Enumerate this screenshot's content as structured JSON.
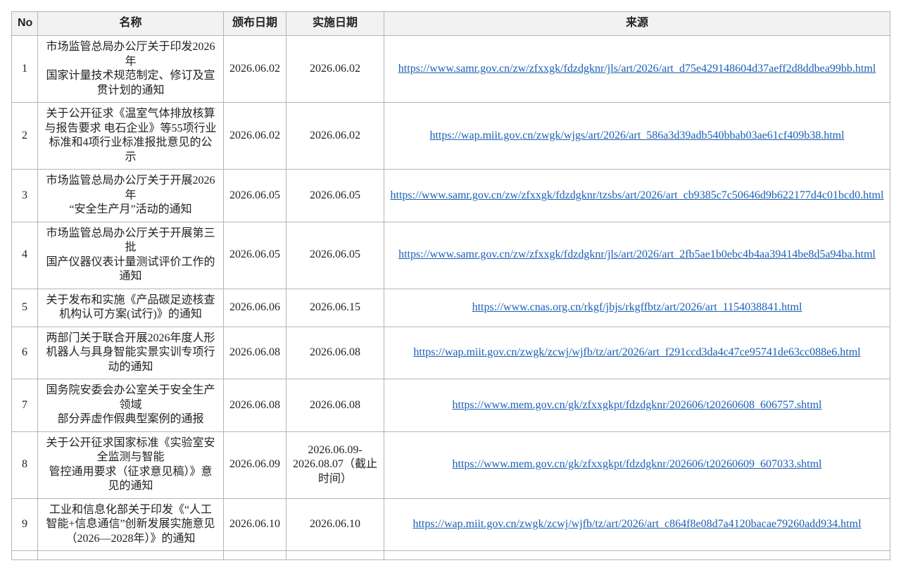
{
  "table": {
    "headers": {
      "no": "No",
      "name": "名称",
      "issue_date": "颁布日期",
      "impl_date": "实施日期",
      "source": "来源"
    },
    "rows": [
      {
        "no": "1",
        "name": "市场监管总局办公厅关于印发2026年\n国家计量技术规范制定、修订及宣贯计划的通知",
        "issue_date": "2026.06.02",
        "impl_date": "2026.06.02",
        "source": "https://www.samr.gov.cn/zw/zfxxgk/fdzdgknr/jls/art/2026/art_d75e429148604d37aeff2d8ddbea99bb.html"
      },
      {
        "no": "2",
        "name": "关于公开征求《温室气体排放核算与报告要求 电石企业》等55项行业标准和4项行业标准报批意见的公示",
        "issue_date": "2026.06.02",
        "impl_date": "2026.06.02",
        "source": "https://wap.miit.gov.cn/zwgk/wjgs/art/2026/art_586a3d39adb540bbab03ae61cf409b38.html"
      },
      {
        "no": "3",
        "name": "市场监管总局办公厅关于开展2026年\n“安全生产月”活动的通知",
        "issue_date": "2026.06.05",
        "impl_date": "2026.06.05",
        "source": "https://www.samr.gov.cn/zw/zfxxgk/fdzdgknr/tzsbs/art/2026/art_cb9385c7c50646d9b622177d4c01bcd0.html"
      },
      {
        "no": "4",
        "name": "市场监管总局办公厅关于开展第三批\n国产仪器仪表计量测试评价工作的通知",
        "issue_date": "2026.06.05",
        "impl_date": "2026.06.05",
        "source": "https://www.samr.gov.cn/zw/zfxxgk/fdzdgknr/jls/art/2026/art_2fb5ae1b0ebc4b4aa39414be8d5a94ba.html"
      },
      {
        "no": "5",
        "name": "关于发布和实施《产品碳足迹核查机构认可方案(试行)》的通知",
        "issue_date": "2026.06.06",
        "impl_date": "2026.06.15",
        "source": "https://www.cnas.org.cn/rkgf/jbjs/rkgffbtz/art/2026/art_1154038841.html"
      },
      {
        "no": "6",
        "name": "两部门关于联合开展2026年度人形机器人与具身智能实景实训专项行动的通知",
        "issue_date": "2026.06.08",
        "impl_date": "2026.06.08",
        "source": "https://wap.miit.gov.cn/zwgk/zcwj/wjfb/tz/art/2026/art_f291ccd3da4c47ce95741de63cc088e6.html"
      },
      {
        "no": "7",
        "name": "国务院安委会办公室关于安全生产领域\n部分弄虚作假典型案例的通报",
        "issue_date": "2026.06.08",
        "impl_date": "2026.06.08",
        "source": "https://www.mem.gov.cn/gk/zfxxgkpt/fdzdgknr/202606/t20260608_606757.shtml"
      },
      {
        "no": "8",
        "name": "关于公开征求国家标准《实验室安全监测与智能\n管控通用要求（征求意见稿）》意见的通知",
        "issue_date": "2026.06.09",
        "impl_date": "2026.06.09-2026.08.07（截止时间）",
        "source": "https://www.mem.gov.cn/gk/zfxxgkpt/fdzdgknr/202606/t20260609_607033.shtml"
      },
      {
        "no": "9",
        "name": "工业和信息化部关于印发《“人工智能+信息通信”创新发展实施意见（2026—2028年）》的通知",
        "issue_date": "2026.06.10",
        "impl_date": "2026.06.10",
        "source": "https://wap.miit.gov.cn/zwgk/zcwj/wjfb/tz/art/2026/art_c864f8e08d7a4120bacae79260add934.html"
      },
      {
        "no": "",
        "name": "",
        "issue_date": "",
        "impl_date": "",
        "source": ""
      }
    ]
  }
}
